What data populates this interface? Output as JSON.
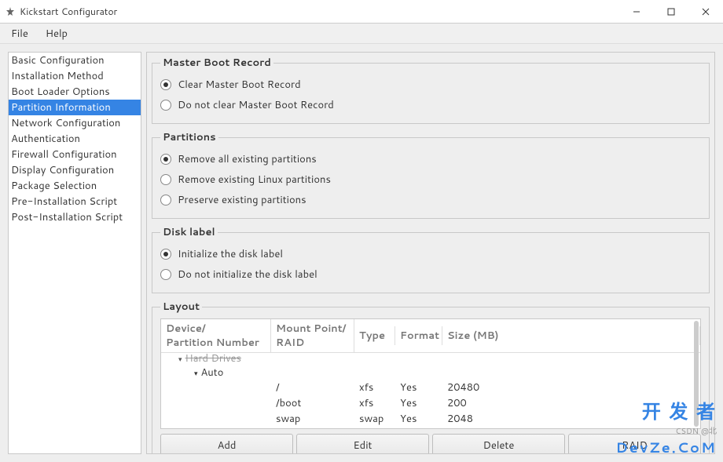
{
  "window": {
    "title": "Kickstart Configurator"
  },
  "menu": {
    "file": "File",
    "help": "Help"
  },
  "sidebar": {
    "items": [
      "Basic Configuration",
      "Installation Method",
      "Boot Loader Options",
      "Partition Information",
      "Network Configuration",
      "Authentication",
      "Firewall Configuration",
      "Display Configuration",
      "Package Selection",
      "Pre-Installation Script",
      "Post-Installation Script"
    ],
    "selected_index": 3
  },
  "mbr": {
    "legend": "Master Boot Record",
    "opt_clear": "Clear Master Boot Record",
    "opt_noclear": "Do not clear Master Boot Record",
    "selected": "clear"
  },
  "partitions": {
    "legend": "Partitions",
    "opt_remove_all": "Remove all existing partitions",
    "opt_remove_linux": "Remove existing Linux partitions",
    "opt_preserve": "Preserve existing partitions",
    "selected": "remove_all"
  },
  "disklabel": {
    "legend": "Disk label",
    "opt_init": "Initialize the disk label",
    "opt_noinit": "Do not initialize the disk label",
    "selected": "init"
  },
  "layout": {
    "legend": "Layout",
    "headers": {
      "device": "Device/\nPartition Number",
      "mount": "Mount Point/\nRAID",
      "type": "Type",
      "format": "Format",
      "size": "Size (MB)"
    },
    "tree": {
      "root": "Hard Drives",
      "auto": "Auto"
    },
    "rows": [
      {
        "mount": "/",
        "type": "xfs",
        "format": "Yes",
        "size": "20480"
      },
      {
        "mount": "/boot",
        "type": "xfs",
        "format": "Yes",
        "size": "200"
      },
      {
        "mount": "swap",
        "type": "swap",
        "format": "Yes",
        "size": "2048"
      }
    ],
    "buttons": {
      "add": "Add",
      "edit": "Edit",
      "delete": "Delete",
      "raid": "RAID"
    }
  },
  "watermark": {
    "small": "CSDN @北",
    "big1": "开 发 者",
    "big2": "DevZe.CoM"
  }
}
